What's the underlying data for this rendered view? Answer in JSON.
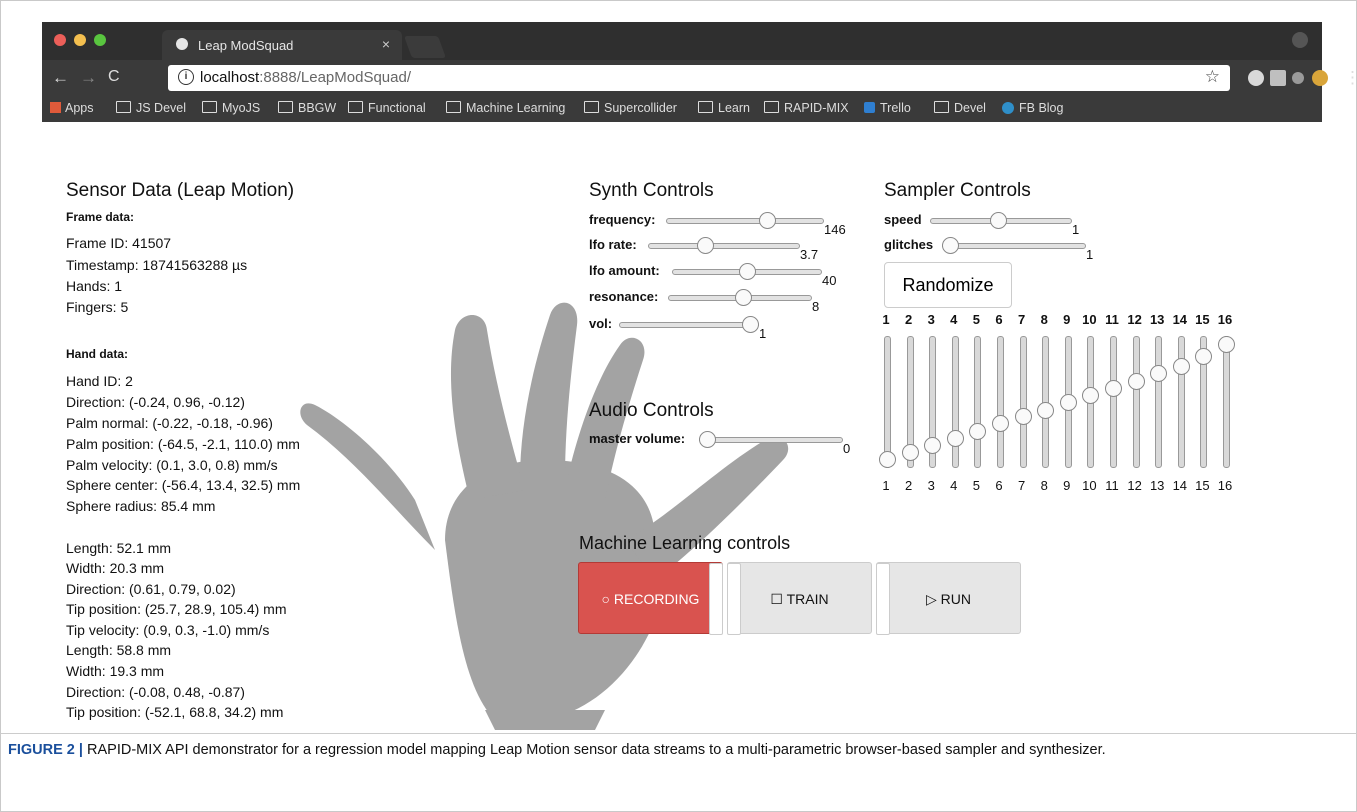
{
  "browser": {
    "tab_title": "Leap ModSquad",
    "tab_close": "×",
    "url_host": "localhost",
    "url_rest": ":8888/LeapModSquad/",
    "bookmarks": [
      "Apps",
      "JS Devel",
      "MyoJS",
      "BBGW",
      "Functional",
      "Machine Learning",
      "Supercollider",
      "Learn",
      "RAPID-MIX",
      "Trello",
      "Devel",
      "FB Blog"
    ],
    "icons": [
      "back-arrow-icon",
      "forward-arrow-icon",
      "reload-icon",
      "info-icon",
      "star-icon",
      "folder-icon"
    ]
  },
  "sensor": {
    "title": "Sensor Data (Leap Motion)",
    "frame_heading": "Frame data:",
    "frame_lines": [
      "Frame ID: 41507",
      "Timestamp: 18741563288 µs",
      "Hands: 1",
      "Fingers: 5"
    ],
    "hand_heading": "Hand data:",
    "hand_lines": [
      "Hand ID: 2",
      "Direction: (-0.24, 0.96, -0.12)",
      "Palm normal: (-0.22, -0.18, -0.96)",
      "Palm position: (-64.5, -2.1, 110.0) mm",
      "Palm velocity: (0.1, 3.0, 0.8) mm/s",
      "Sphere center: (-56.4, 13.4, 32.5) mm",
      "Sphere radius: 85.4 mm"
    ],
    "finger_lines": [
      "Length: 52.1 mm",
      "Width: 20.3 mm",
      "Direction: (0.61, 0.79, 0.02)",
      "Tip position: (25.7, 28.9, 105.4) mm",
      "Tip velocity: (0.9, 0.3, -1.0) mm/s",
      "Length: 58.8 mm",
      "Width: 19.3 mm",
      "Direction: (-0.08, 0.48, -0.87)",
      "Tip position: (-52.1, 68.8, 34.2) mm"
    ]
  },
  "synth": {
    "title": "Synth Controls",
    "sliders": [
      {
        "label": "frequency:",
        "value": "146",
        "level": 0.66
      },
      {
        "label": "lfo rate:",
        "value": "3.7",
        "level": 0.36
      },
      {
        "label": "lfo amount:",
        "value": "40",
        "level": 0.5
      },
      {
        "label": "resonance:",
        "value": "8",
        "level": 0.53
      },
      {
        "label": "vol:",
        "value": "1",
        "level": 1.0
      }
    ]
  },
  "audio": {
    "title": "Audio Controls",
    "sliders": [
      {
        "label": "master volume:",
        "value": "0",
        "level": 0.0
      }
    ]
  },
  "sampler": {
    "title": "Sampler Controls",
    "sliders": [
      {
        "label": "speed",
        "value": "1",
        "level": 0.48
      },
      {
        "label": "glitches",
        "value": "1",
        "level": 0.0
      }
    ],
    "randomize_label": "Randomize",
    "channels": [
      "1",
      "2",
      "3",
      "4",
      "5",
      "6",
      "7",
      "8",
      "9",
      "10",
      "11",
      "12",
      "13",
      "14",
      "15",
      "16"
    ],
    "channel_levels": [
      0.0,
      0.06,
      0.12,
      0.18,
      0.24,
      0.31,
      0.37,
      0.43,
      0.5,
      0.56,
      0.62,
      0.68,
      0.75,
      0.81,
      0.9,
      1.0
    ]
  },
  "ml": {
    "title": "Machine Learning controls",
    "buttons": [
      {
        "label": "RECORDING",
        "icon": "○"
      },
      {
        "label": "TRAIN",
        "icon": "☐"
      },
      {
        "label": "RUN",
        "icon": "▷"
      }
    ]
  },
  "caption": {
    "figure_label": "FIGURE 2 |",
    "text": "RAPID-MIX API demonstrator for a regression model mapping Leap Motion sensor data streams to a multi-parametric browser-based sampler and synthesizer."
  },
  "colors": {
    "record": "#d9534f",
    "button_bg": "#e6e6e6",
    "hand": "#9e9e9e",
    "chrome": "#2f2f2f"
  }
}
